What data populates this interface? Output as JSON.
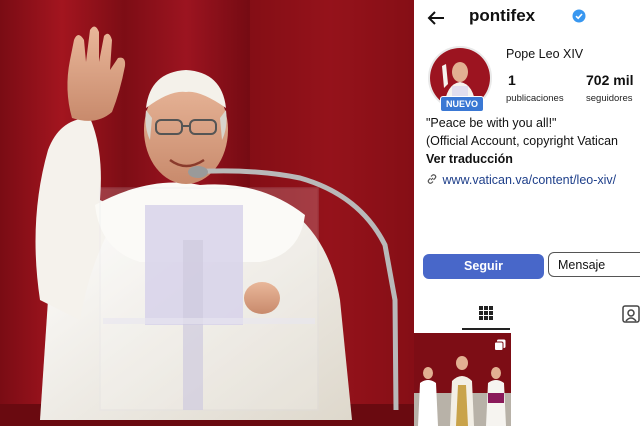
{
  "profile": {
    "username": "pontifex",
    "display_name": "Pope Leo XIV",
    "new_badge": "NUEVO",
    "stats": {
      "posts_count": "1",
      "posts_label": "publicaciones",
      "followers_count": "702 mil",
      "followers_label": "seguidores"
    },
    "bio_line1": "\"Peace be with you all!\"",
    "bio_line2": "(Official Account, copyright Vatican",
    "see_translation": "Ver traducción",
    "link": "www.vatican.va/content/leo-xiv/"
  },
  "actions": {
    "follow": "Seguir",
    "message": "Mensaje"
  },
  "tabs": [
    "grid-tab",
    "tagged-tab"
  ],
  "icons": [
    "back-arrow-icon",
    "verified-badge-icon",
    "link-icon",
    "grid-icon",
    "tagged-person-icon",
    "multiple-posts-icon"
  ],
  "colors": {
    "follow_button": "#4867c9",
    "new_badge": "#3a78d4",
    "verified": "#3897f0",
    "link": "#1e3f8a",
    "background_red": "#8e1018"
  }
}
